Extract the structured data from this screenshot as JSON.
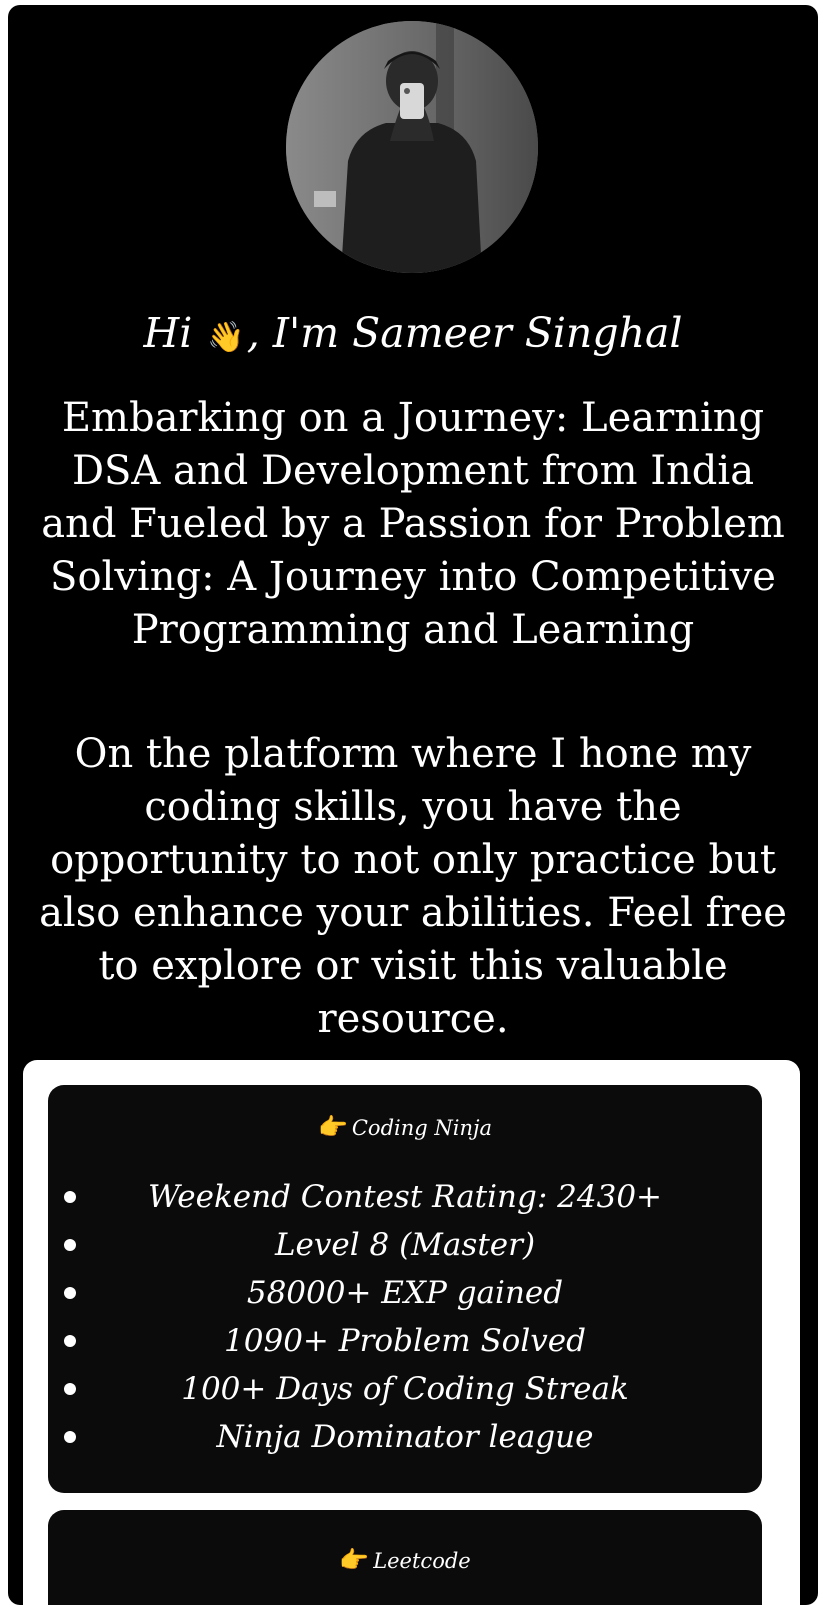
{
  "profile": {
    "greeting_prefix": "Hi",
    "wave_emoji": "👋",
    "greeting_suffix": ", I'm Sameer Singhal"
  },
  "intro": {
    "paragraph_1": "Embarking on a Journey: Learning DSA and Development from India and Fueled by a Passion for Problem Solving: A Journey into Competitive Programming and Learning",
    "paragraph_2": "On the platform where I hone my coding skills, you have the opportunity to not only practice but also enhance your abilities. Feel free to explore or visit this valuable resource."
  },
  "cards": [
    {
      "pointer_icon": "👉",
      "title": "Coding Ninja",
      "items": [
        "Weekend Contest Rating: 2430+",
        "Level 8 (Master)",
        "58000+ EXP gained",
        "1090+ Problem Solved",
        "100+ Days of Coding Streak",
        "Ninja Dominator league"
      ]
    },
    {
      "pointer_icon": "👉",
      "title": "Leetcode"
    }
  ],
  "colors": {
    "background": "#000000",
    "panel": "#ffffff",
    "card": "#0b0b0b",
    "text": "#ffffff",
    "emoji_accent": "#f2c84b"
  }
}
